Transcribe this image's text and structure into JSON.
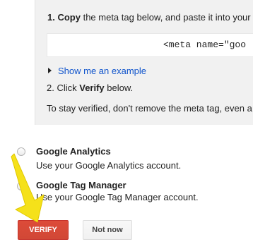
{
  "instructions": {
    "step1_number": "1.",
    "step1_bold": "Copy",
    "step1_rest": " the meta tag below, and paste it into your",
    "meta_tag_code": "<meta name=\"goo",
    "show_example_label": "Show me an example",
    "step2_prefix": "2. Click ",
    "step2_bold": "Verify",
    "step2_suffix": " below.",
    "stay_verified_note": "To stay verified, don't remove the meta tag, even a"
  },
  "options": [
    {
      "title": "Google Analytics",
      "description": "Use your Google Analytics account.",
      "selected": false
    },
    {
      "title": "Google Tag Manager",
      "description": "Use your Google Tag Manager account.",
      "selected": false
    }
  ],
  "buttons": {
    "verify_label": "VERIFY",
    "not_now_label": "Not now"
  },
  "colors": {
    "verify_button": "#d14836",
    "link": "#1155cc",
    "instruction_background": "#f1f1f1",
    "annotation_arrow": "#f5e11a"
  },
  "icons": {
    "expand": "triangle-right-icon",
    "annotation": "yellow-arrow-icon"
  }
}
